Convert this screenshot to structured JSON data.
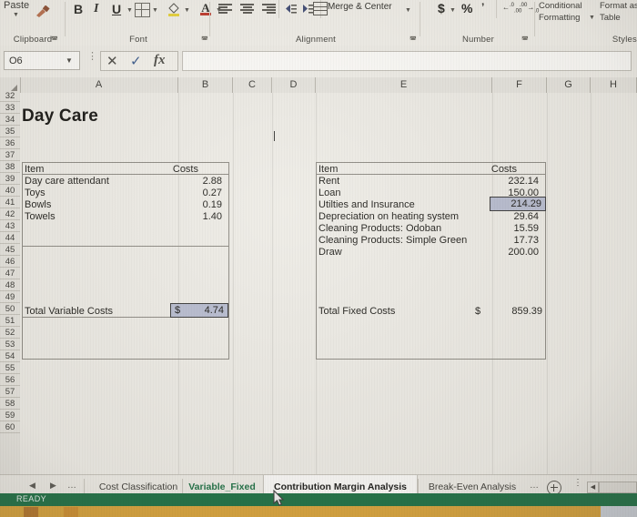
{
  "ribbon": {
    "groups": [
      {
        "name": "Clipboard",
        "label": "Clipboard"
      },
      {
        "name": "Font",
        "label": "Font"
      },
      {
        "name": "Alignment",
        "label": "Alignment"
      },
      {
        "name": "Number",
        "label": "Number"
      },
      {
        "name": "Styles",
        "label": "Styles"
      }
    ],
    "clipboard": {
      "paste_label": "Paste",
      "format_painter": "format-painter-icon"
    },
    "font": {
      "bold": "B",
      "italic": "I",
      "underline": "U"
    },
    "alignment": {
      "merge_center": "Merge & Center"
    },
    "number": {
      "currency": "$",
      "percent": "%",
      "comma": "’"
    },
    "styles": {
      "conditional": "Conditional",
      "formatting": "Formatting",
      "table1": "Format as",
      "table2": "Table"
    }
  },
  "formula_bar": {
    "name_box": "O6",
    "formula": "",
    "placeholder": "",
    "cancel": "✕",
    "enter": "✓",
    "fx": "fx"
  },
  "grid": {
    "columns": [
      "A",
      "B",
      "C",
      "D",
      "E",
      "F",
      "G",
      "H"
    ],
    "rows": [
      32,
      33,
      34,
      35,
      36,
      37,
      38,
      39,
      40,
      41,
      42,
      43,
      44,
      45,
      46,
      47,
      48,
      49,
      50,
      51,
      52,
      53,
      54,
      55,
      56,
      57,
      58,
      59,
      60
    ],
    "title": "Day Care"
  },
  "variable_table": {
    "header": {
      "item": "Item",
      "costs": "Costs"
    },
    "rows": [
      {
        "item": "Day care attendant",
        "cost": "2.88"
      },
      {
        "item": "Toys",
        "cost": "0.27"
      },
      {
        "item": "Bowls",
        "cost": "0.19"
      },
      {
        "item": "Towels",
        "cost": "1.40"
      }
    ],
    "total_label": "Total Variable Costs",
    "total_currency": "$",
    "total_value": "4.74"
  },
  "fixed_table": {
    "header": {
      "item": "Item",
      "costs": "Costs"
    },
    "rows": [
      {
        "item": "Rent",
        "cost": "232.14"
      },
      {
        "item": "Loan",
        "cost": "150.00"
      },
      {
        "item": "Utilties and Insurance",
        "cost": "214.29"
      },
      {
        "item": "Depreciation on heating system",
        "cost": "29.64"
      },
      {
        "item": "Cleaning Products: Odoban",
        "cost": "15.59"
      },
      {
        "item": "Cleaning Products: Simple Green",
        "cost": "17.73"
      },
      {
        "item": "Draw",
        "cost": "200.00"
      }
    ],
    "total_label": "Total Fixed Costs",
    "total_currency": "$",
    "total_value": "859.39"
  },
  "sheet_tabs": {
    "tabs": [
      {
        "label": "Cost Classification",
        "state": "normal"
      },
      {
        "label": "Variable_Fixed",
        "state": "green"
      },
      {
        "label": "Contribution Margin Analysis",
        "state": "active"
      },
      {
        "label": "Break-Even Analysis",
        "state": "normal"
      }
    ],
    "overflow": "…",
    "add_label": "+"
  },
  "status_bar": {
    "text": "READY"
  },
  "colors": {
    "excel_green": "#1d7044",
    "selection_fill": "#b8bdd0",
    "ribbon_bg": "#f1efe9",
    "grid_bg": "#eeece6"
  }
}
